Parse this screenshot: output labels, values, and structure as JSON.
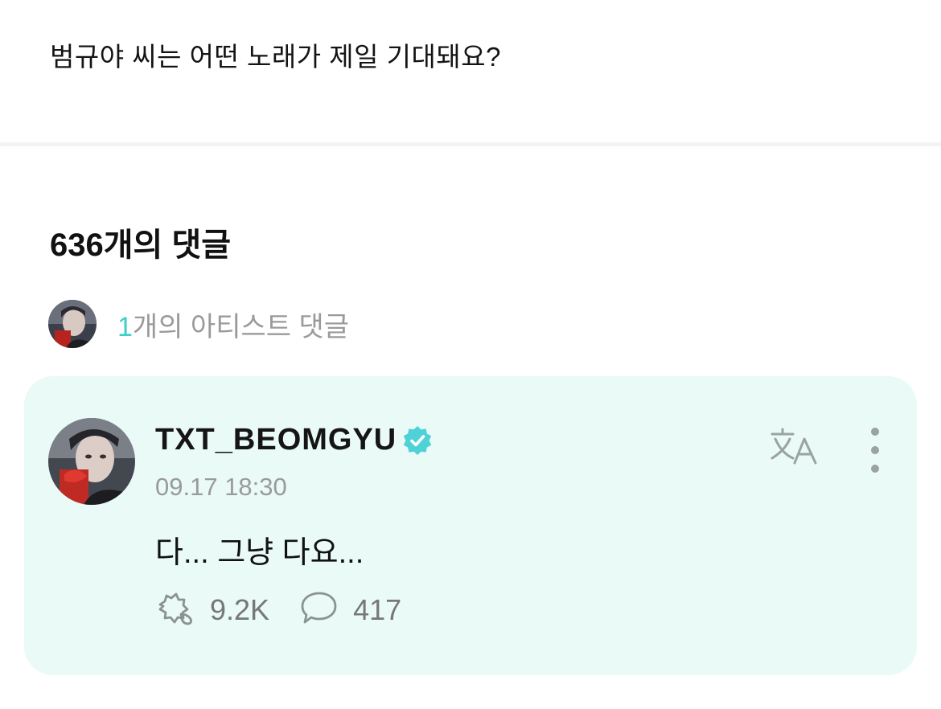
{
  "post": {
    "text": "범규야 씨는 어떤 노래가 제일 기대돼요?"
  },
  "comments": {
    "title": "636개의 댓글",
    "artist_count": "1",
    "artist_label": "개의 아티스트 댓글"
  },
  "comment": {
    "username": "TXT_BEOMGYU",
    "timestamp": "09.17 18:30",
    "body": "다... 그냥 다요...",
    "likes": "9.2K",
    "replies": "417"
  },
  "colors": {
    "accent": "#3ecfc9",
    "card_bg": "#e9faf7",
    "verified": "#4fd1d8",
    "muted": "#9a9a9a"
  },
  "icons": {
    "verified": "verified-badge-icon",
    "translate": "translate-icon",
    "more": "more-vertical-icon",
    "like": "cheer-icon",
    "reply": "comment-bubble-icon"
  }
}
